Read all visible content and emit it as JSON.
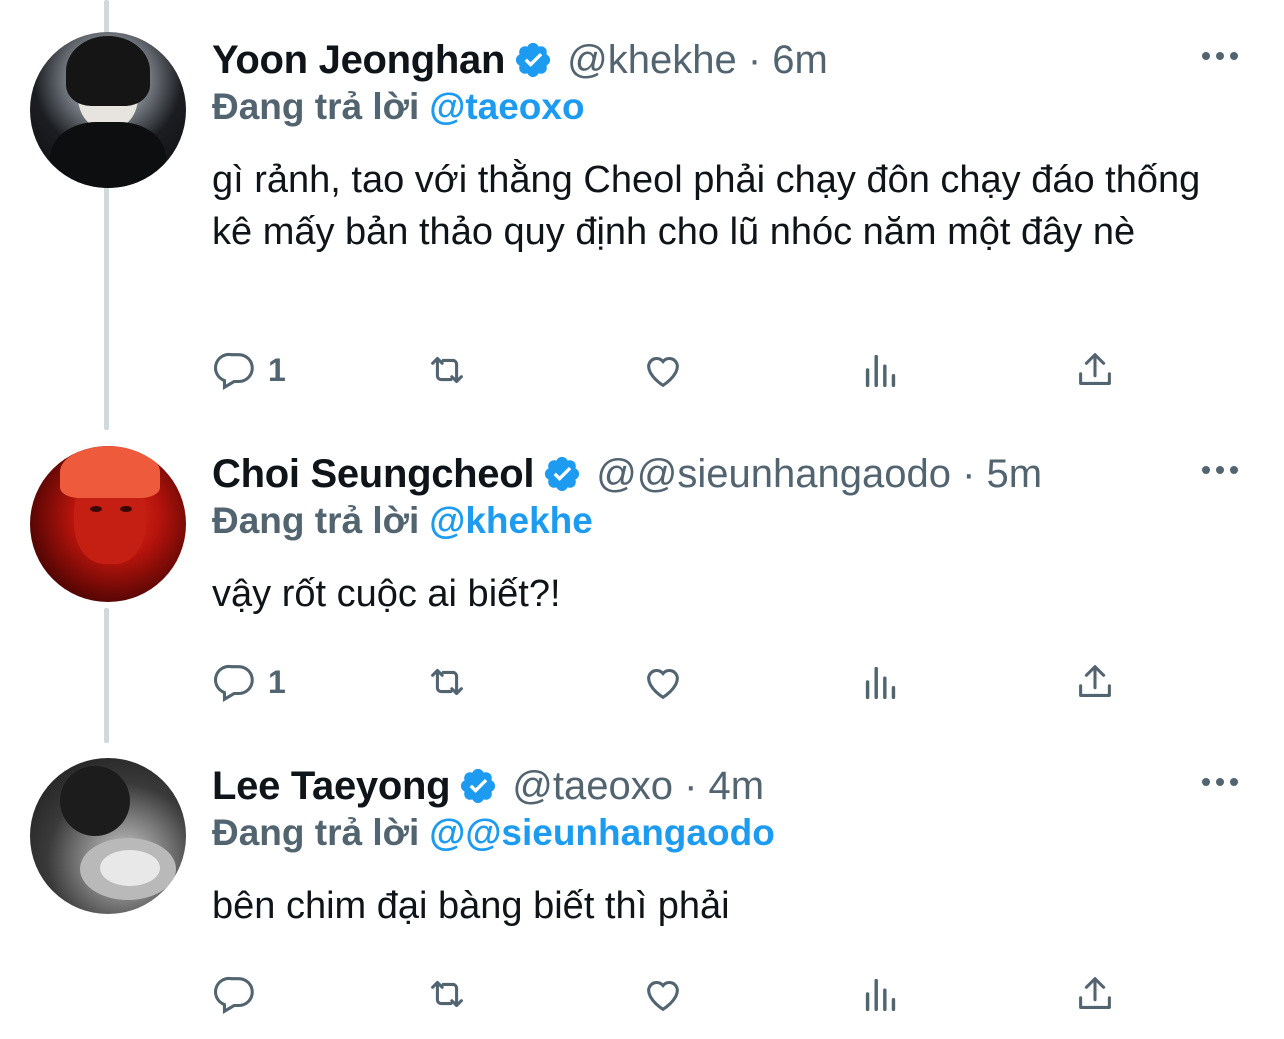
{
  "tweets": [
    {
      "name": "Yoon Jeonghan",
      "handle": "@khekhe · 6m",
      "reply_label": "Đang trả lời",
      "reply_mention": "@taeoxo",
      "body": "gì rảnh, tao với thằng Cheol phải chạy đôn chạy đáo thống kê mấy bản thảo quy định cho lũ nhóc năm một đây nè",
      "reply_count": "1"
    },
    {
      "name": "Choi Seungcheol",
      "handle": "@@sieunhangaodo · 5m",
      "reply_label": "Đang trả lời",
      "reply_mention": "@khekhe",
      "body": "vậy rốt cuộc ai biết?!",
      "reply_count": "1"
    },
    {
      "name": "Lee Taeyong",
      "handle": "@taeoxo · 4m",
      "reply_label": "Đang trả lời",
      "reply_mention": "@@sieunhangaodo",
      "body": "bên chim đại bàng biết thì phải",
      "reply_count": ""
    }
  ],
  "icons": {
    "verified": "verified-badge-icon",
    "more": "more-dots-icon",
    "reply": "reply-bubble-icon",
    "retweet": "retweet-icon",
    "like": "heart-icon",
    "views": "analytics-bars-icon",
    "share": "share-upload-icon"
  },
  "colors": {
    "accent": "#1d9bf0",
    "secondary_text": "#536471",
    "thread_line": "#cfd9de"
  }
}
